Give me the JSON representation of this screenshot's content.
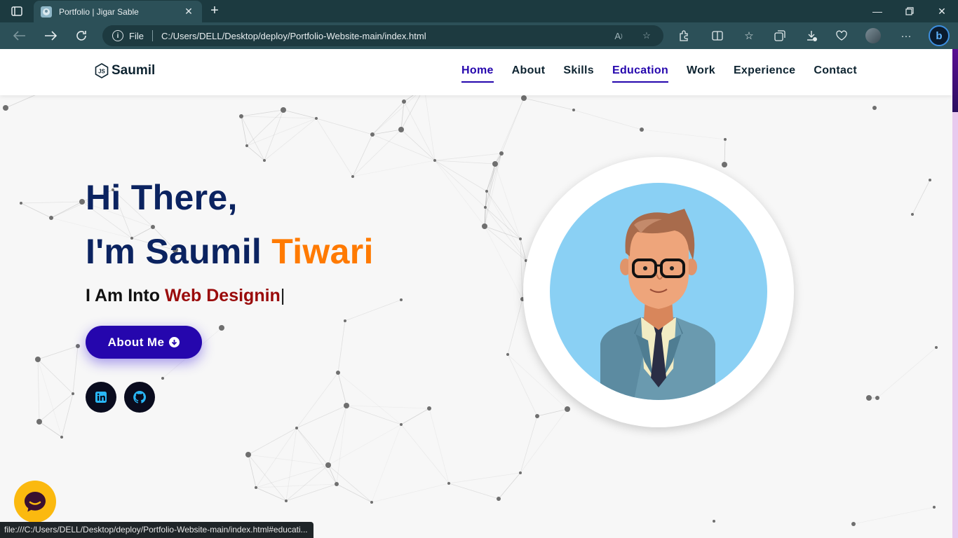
{
  "browser": {
    "tab_title": "Portfolio | Jigar Sable",
    "address_scheme": "File",
    "address_url": "C:/Users/DELL/Desktop/deploy/Portfolio-Website-main/index.html",
    "status_url": "file:///C:/Users/DELL/Desktop/deploy/Portfolio-Website-main/index.html#educati..."
  },
  "site": {
    "brand": "Saumil",
    "nav": [
      {
        "label": "Home",
        "active": true
      },
      {
        "label": "About",
        "active": false
      },
      {
        "label": "Skills",
        "active": false
      },
      {
        "label": "Education",
        "active": true
      },
      {
        "label": "Work",
        "active": false
      },
      {
        "label": "Experience",
        "active": false
      },
      {
        "label": "Contact",
        "active": false
      }
    ]
  },
  "hero": {
    "greeting": "Hi There,",
    "intro": "I'm Saumil",
    "surname": "Tiwari",
    "typed_prefix": "I Am Into",
    "typed_text": "Web Designin",
    "cursor": "|",
    "cta_label": "About Me"
  },
  "social": [
    {
      "icon": "linkedin-icon"
    },
    {
      "icon": "github-icon"
    }
  ],
  "colors": {
    "primary": "#2506ad",
    "heading": "#0b2360",
    "accent_orange": "#ff7a00",
    "typed_red": "#9a0b0b",
    "chat": "#fbb90f"
  }
}
